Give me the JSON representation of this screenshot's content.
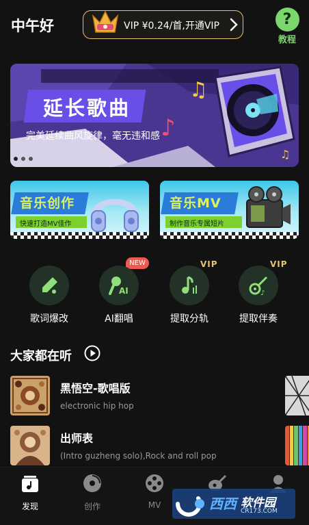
{
  "header": {
    "greeting": "中午好",
    "vip_text": "VIP  ¥0.24/首,开通VIP",
    "tutorial_icon": "?",
    "tutorial_label": "教程"
  },
  "banner": {
    "title": "延长歌曲",
    "subtitle": "完美延续曲风旋律，毫无违和感",
    "slides": 3,
    "active_slide": 1
  },
  "feature_cards": [
    {
      "title": "音乐创作",
      "subtitle": "快速打造MV佳作",
      "icon": "headphones-icon"
    },
    {
      "title": "音乐MV",
      "subtitle": "制作音乐专属短片",
      "icon": "film-projector-icon"
    }
  ],
  "tools": [
    {
      "label": "歌词爆改",
      "icon": "pen-icon"
    },
    {
      "label": "AI翻唱",
      "icon": "ai-mic-icon",
      "badge": "NEW"
    },
    {
      "label": "提取分轨",
      "icon": "music-track-icon",
      "badge": "VIP"
    },
    {
      "label": "提取伴奏",
      "icon": "guitar-icon",
      "badge": "VIP"
    }
  ],
  "section": {
    "title": "大家都在听"
  },
  "songs": [
    {
      "title": "黑悟空-歌唱版",
      "genre": "electronic hip hop"
    },
    {
      "title": "出师表",
      "genre": "(Intro guzheng solo),Rock and roll pop"
    }
  ],
  "tabbar": [
    {
      "label": "发现",
      "icon": "discover-icon",
      "active": true
    },
    {
      "label": "创作",
      "icon": "disc-icon",
      "active": false
    },
    {
      "label": "MV",
      "icon": "film-reel-icon",
      "active": false
    },
    {
      "label": "",
      "icon": "guitar-bird-icon",
      "active": false
    },
    {
      "label": "",
      "icon": "profile-icon",
      "active": false
    }
  ],
  "watermark": {
    "name_a": "西西",
    "name_b": "软件园",
    "url": "CR173.COM"
  },
  "colors": {
    "accent_green": "#7bd66c",
    "vip_gold": "#e9c46a",
    "badge_red": "#f0594f",
    "background": "#121212"
  }
}
